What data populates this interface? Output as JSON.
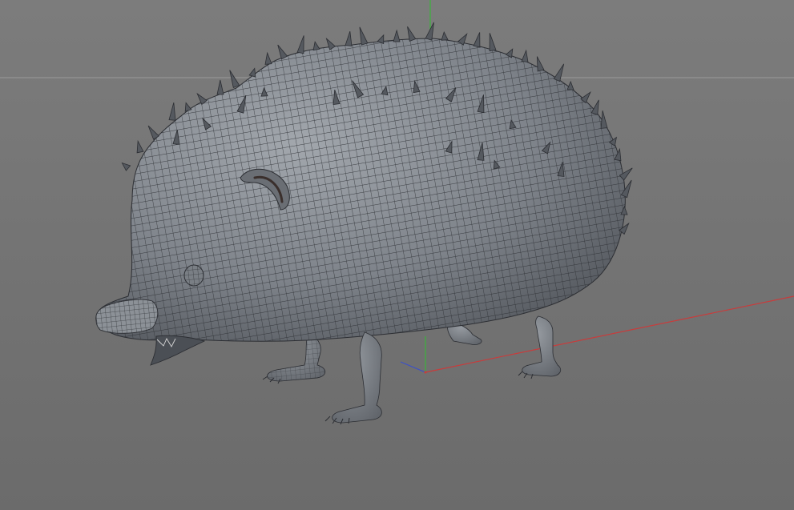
{
  "viewport": {
    "colors": {
      "background_top": "#7c7c7c",
      "background_bottom": "#6b6b6b",
      "horizon_line": "#9a9a9a",
      "axis_x": "#c83c3c",
      "axis_y": "#3cb43c",
      "axis_z": "#3c50c8",
      "mesh_fill": "#858a90",
      "mesh_wire": "#2c2e33",
      "spine": "#55595f"
    },
    "model": {
      "display_mode": "shaded-wireframe"
    }
  }
}
